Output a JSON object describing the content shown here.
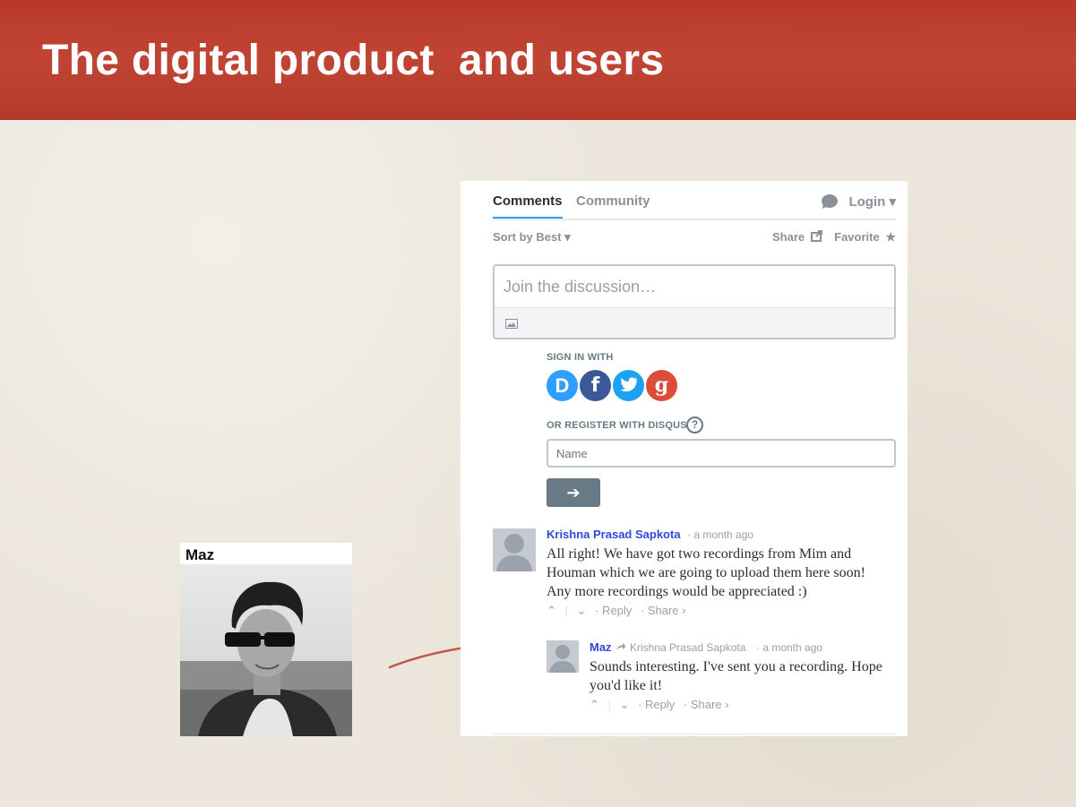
{
  "slide": {
    "title": "The digital product  and users"
  },
  "profile": {
    "name": "Maz"
  },
  "disqus": {
    "tabs": {
      "comments": "Comments",
      "community": "Community"
    },
    "login": "Login ▾",
    "sort": "Sort by Best ▾",
    "share": "Share",
    "favorite": "Favorite",
    "compose_placeholder": "Join the discussion…",
    "sign_in_with": "SIGN IN WITH",
    "social_buttons": [
      "D",
      "f",
      "🐦",
      "g"
    ],
    "register_with": "OR REGISTER WITH DISQUS",
    "help": "?",
    "name_placeholder": "Name",
    "submit_glyph": "➔",
    "colors": {
      "accent": "#2e9fff",
      "author": "#2e48d9",
      "facebook": "#3b5998",
      "twitter": "#1da1f2",
      "google": "#dd4b39"
    },
    "comments": [
      {
        "author": "Krishna Prasad Sapkota",
        "time": "· a month ago",
        "text_lines": [
          "All right! We have got two recordings from Mim and",
          "Houman which we are going to upload them here soon!",
          "Any more recordings would be appreciated :)"
        ],
        "actions": {
          "up": "⌃",
          "sep": "|",
          "down": "⌄",
          "reply": "· Reply",
          "share": "· Share ›"
        }
      },
      {
        "author": "Maz",
        "reply_to": "Krishna Prasad Sapkota",
        "time": "· a month ago",
        "text_lines": [
          "Sounds interesting. I've sent you a recording. Hope",
          "you'd like it!"
        ],
        "actions": {
          "up": "⌃",
          "sep": "|",
          "down": "⌄",
          "reply": "· Reply",
          "share": "· Share ›"
        }
      }
    ]
  }
}
